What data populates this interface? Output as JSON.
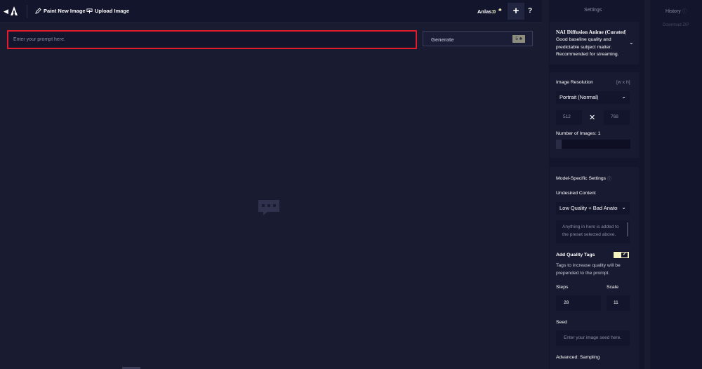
{
  "topbar": {
    "paint_label": "Paint New Image",
    "upload_label": "Upload Image",
    "anlas_label": "Anlas:",
    "anlas_value": "0",
    "plus_label": "+",
    "help_label": "?"
  },
  "prompt": {
    "placeholder": "Enter your prompt here.",
    "generate_label": "Generate",
    "generate_cost": "5"
  },
  "settings": {
    "title": "Settings",
    "model": {
      "name": "NAI Diffusion Anime (Curated)",
      "description": "Good baseline quality and predictable subject matter. Recommended for streaming."
    },
    "resolution": {
      "label": "Image Resolution",
      "hint": "[w x h]",
      "preset": "Portrait (Normal)",
      "width": "512",
      "times": "✕",
      "height": "768"
    },
    "num_images": {
      "label": "Number of Images:",
      "value": "1",
      "fraction": 0.08
    },
    "model_specific": {
      "title": "Model-Specific Settings",
      "undesired_label": "Undesired Content",
      "undesired_preset": "Low Quality + Bad Anatomy",
      "undesired_placeholder": "Anything in here is added to the preset selected above.",
      "quality_tags_label": "Add Quality Tags",
      "quality_tags_enabled": true,
      "quality_tags_desc": "Tags to increase quality will be prepended to the prompt.",
      "steps_label": "Steps",
      "steps_value": "28",
      "scale_label": "Scale",
      "scale_value": "11",
      "seed_label": "Seed",
      "seed_placeholder": "Enter your image seed here.",
      "advanced_label": "Advanced: Sampling"
    }
  },
  "history": {
    "title": "History",
    "download_label": "Download ZIP"
  },
  "colors": {
    "background": "#191b31",
    "panel": "#13152c",
    "accent": "#f5f3c2",
    "focus_border": "#e01c2c"
  }
}
